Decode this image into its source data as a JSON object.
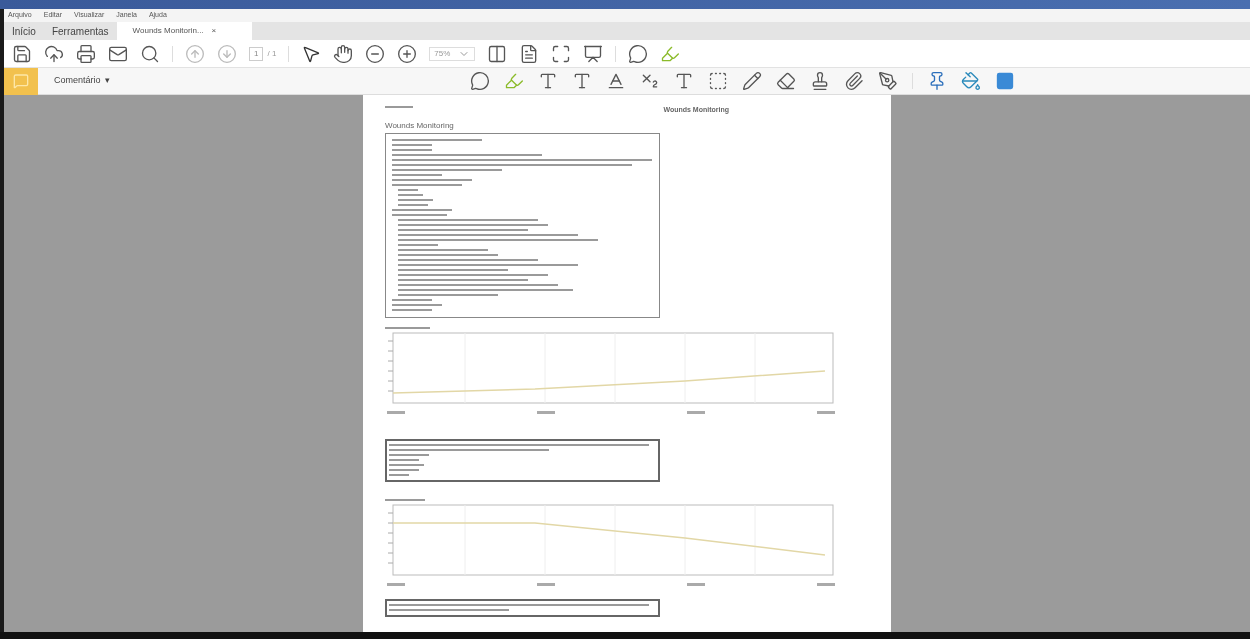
{
  "menu": [
    "Arquivo",
    "Editar",
    "Visualizar",
    "Janela",
    "Ajuda"
  ],
  "tabs": [
    {
      "label": "Início",
      "kind": "nav",
      "selected": false
    },
    {
      "label": "Ferramentas",
      "kind": "nav",
      "selected": false
    },
    {
      "label": "Wounds Monitorin...",
      "kind": "document",
      "selected": true,
      "close": "×"
    }
  ],
  "toolbar": {
    "page_number": "1",
    "page_total": "/ 1",
    "zoom": "75%"
  },
  "comment_bar": {
    "label": "Comentário",
    "caret": "▾"
  },
  "document": {
    "header_title": "Wounds Monitoring",
    "title": "Wounds Monitoring"
  }
}
